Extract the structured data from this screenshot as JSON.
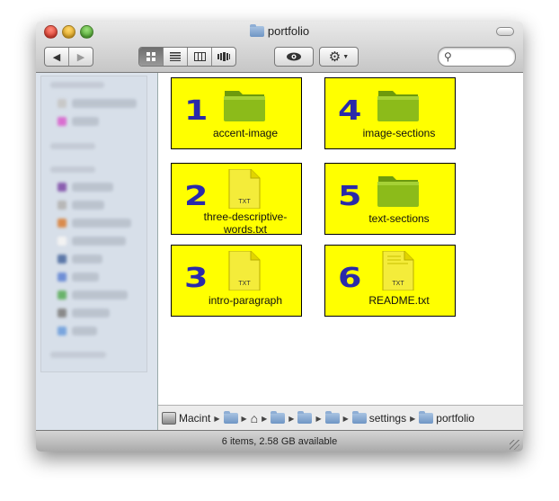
{
  "window": {
    "title": "portfolio",
    "colors": {
      "tile_bg": "#ffff00",
      "number": "#2a2aaa",
      "folder_green": "#7faa10"
    }
  },
  "toolbar": {
    "back_glyph": "◀",
    "forward_glyph": "▶",
    "view_buttons": [
      "icon-view-icon",
      "list-view-icon",
      "column-view-icon",
      "coverflow-view-icon"
    ],
    "quicklook_icon": "eye-icon",
    "action_icon": "gear-icon",
    "search_placeholder": ""
  },
  "items": [
    {
      "number": "1",
      "label": "accent-image",
      "kind": "folder-icon"
    },
    {
      "number": "4",
      "label": "image-sections",
      "kind": "folder-icon"
    },
    {
      "number": "2",
      "label": "three-descriptive-words.txt",
      "kind": "text-file-icon",
      "badge": "TXT"
    },
    {
      "number": "5",
      "label": "text-sections",
      "kind": "folder-icon"
    },
    {
      "number": "3",
      "label": "intro-paragraph",
      "kind": "text-file-icon",
      "badge": "TXT"
    },
    {
      "number": "6",
      "label": "README.txt",
      "kind": "text-file-icon",
      "badge": "TXT"
    }
  ],
  "pathbar": {
    "root": "Macint",
    "settings": "settings",
    "current": "portfolio"
  },
  "status": {
    "text": "6 items, 2.58 GB available"
  }
}
